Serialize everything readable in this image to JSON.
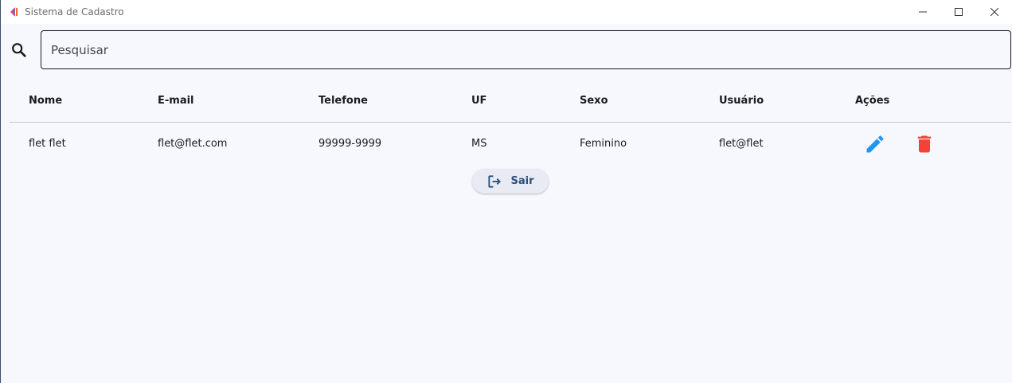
{
  "window": {
    "title": "Sistema de Cadastro",
    "controls": [
      "minimize",
      "maximize",
      "close"
    ]
  },
  "search": {
    "placeholder": "Pesquisar",
    "icon": "search-icon"
  },
  "table": {
    "columns": [
      "Nome",
      "E-mail",
      "Telefone",
      "UF",
      "Sexo",
      "Usuário",
      "Ações"
    ],
    "rows": [
      {
        "nome": "flet flet",
        "email": "flet@flet.com",
        "telefone": "99999-9999",
        "uf": "MS",
        "sexo": "Feminino",
        "usuario": "flet@flet",
        "actions": [
          "edit-icon",
          "delete-icon"
        ]
      }
    ]
  },
  "logout": {
    "label": "Sair",
    "icon": "logout-icon"
  },
  "colors": {
    "edit": "#2196f3",
    "delete": "#f44336",
    "button_text": "#2d4f7c",
    "background": "#f7f8fd"
  }
}
